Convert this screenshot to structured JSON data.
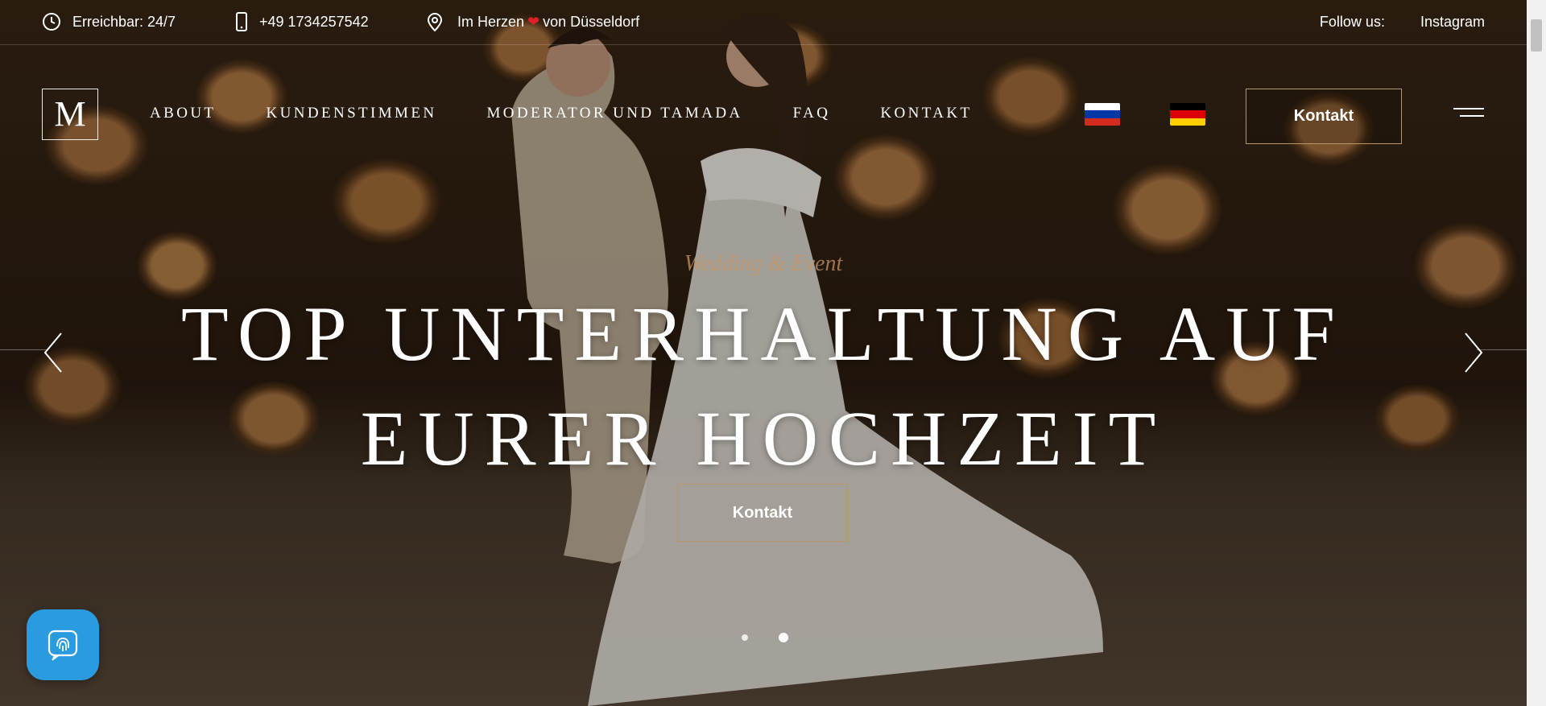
{
  "topbar": {
    "availability": "Erreichbar: 24/7",
    "phone": "+49 1734257542",
    "location_before": "Im Herzen",
    "location_after": "von Düsseldorf",
    "follow_label": "Follow us:",
    "social_link": "Instagram",
    "icons": [
      "clock-icon",
      "phone-icon",
      "map-pin-icon",
      "heart-icon"
    ]
  },
  "header": {
    "logo_letter": "M",
    "nav": [
      "About",
      "Kundenstimmen",
      "Moderator und Tamada",
      "FAQ",
      "Kontakt"
    ],
    "languages": [
      "russian-flag",
      "german-flag"
    ],
    "cta_label": "Kontakt"
  },
  "hero": {
    "eyebrow": "Wedding & Event",
    "headline_line1": "Top Unterhaltung auf",
    "headline_line2": "eurer Hochzeit",
    "cta_label": "Kontakt",
    "slides_total": 2,
    "active_slide": 2
  },
  "colors": {
    "accent_border": "#b7966a",
    "heart": "#e0202a",
    "fingerprint_button": "#2b9be0"
  }
}
